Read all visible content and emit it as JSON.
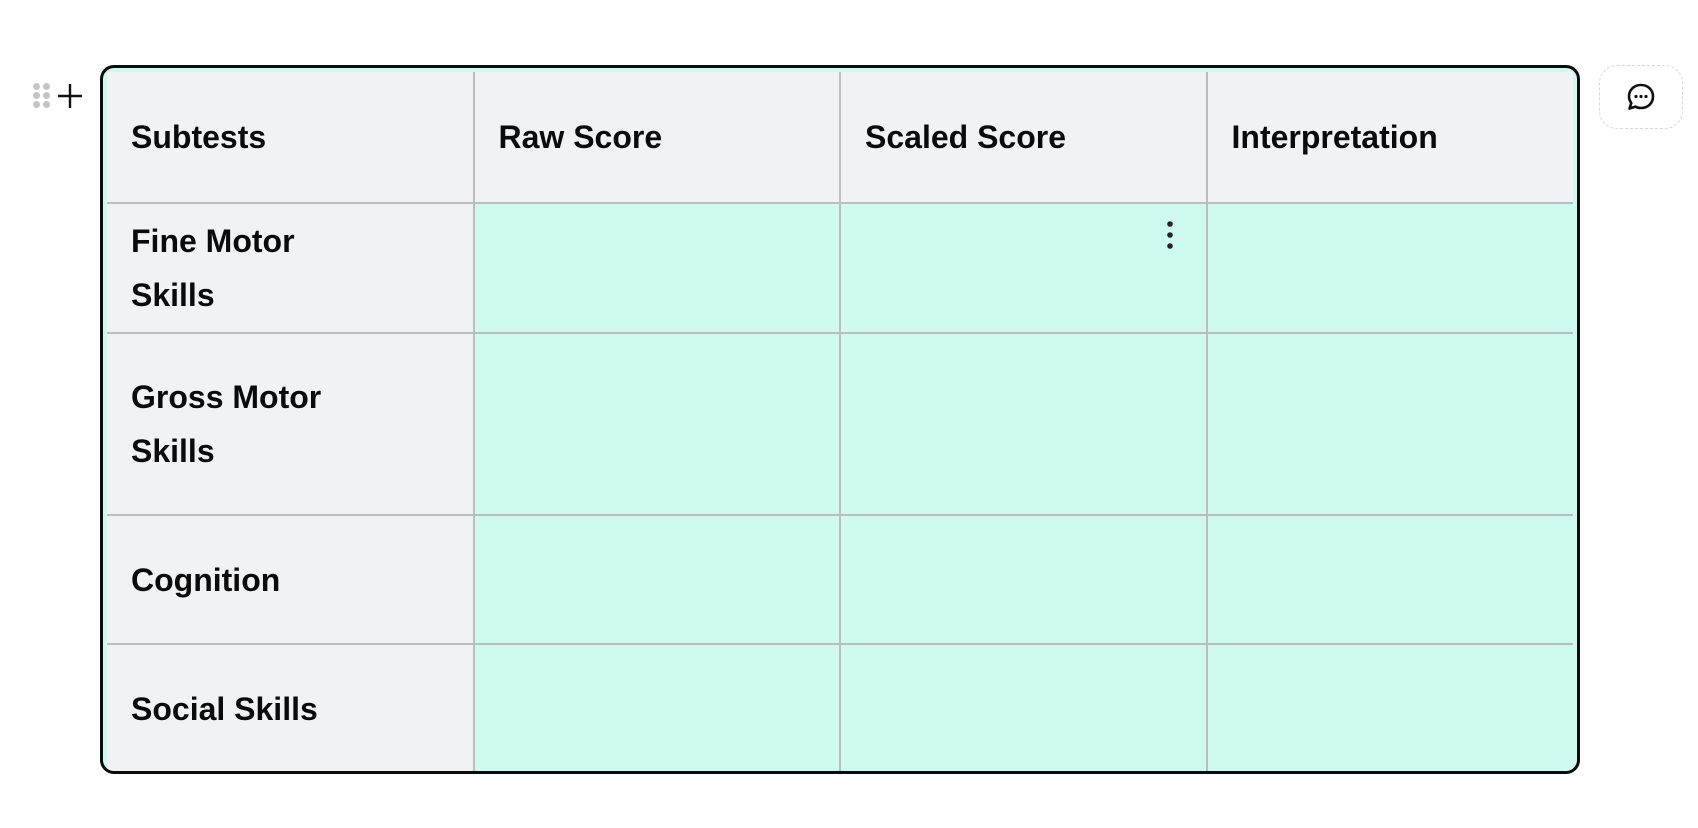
{
  "table": {
    "headers": [
      "Subtests",
      "Raw Score",
      "Scaled Score",
      "Interpretation"
    ],
    "rows": [
      {
        "subtest": "Fine Motor Skills",
        "raw_score": "",
        "scaled_score": "",
        "interpretation": ""
      },
      {
        "subtest": "Gross Motor Skills",
        "raw_score": "",
        "scaled_score": "",
        "interpretation": ""
      },
      {
        "subtest": "Cognition",
        "raw_score": "",
        "scaled_score": "",
        "interpretation": ""
      },
      {
        "subtest": "Social Skills",
        "raw_score": "",
        "scaled_score": "",
        "interpretation": ""
      }
    ]
  },
  "icons": {
    "drag": "drag-handle-icon",
    "add": "plus-icon",
    "cell_menu": "vertical-ellipsis-icon",
    "comment": "comment-bubble-icon"
  },
  "colors": {
    "header_bg": "#f1f2f4",
    "cell_bg": "#cdf9ee",
    "border": "#0b0b0b",
    "grid": "#bdbdbd"
  }
}
